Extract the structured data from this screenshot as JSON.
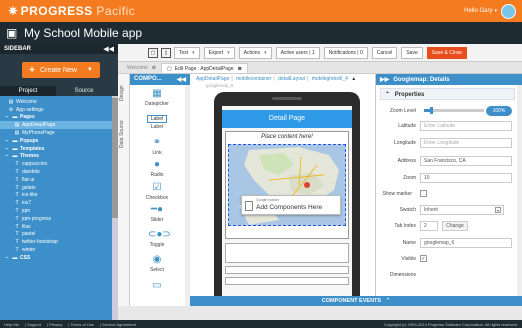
{
  "brand": {
    "name": "PROGRESS",
    "product": "Pacific"
  },
  "user": {
    "greeting": "Hello Gary"
  },
  "app": {
    "title": "My School Mobile app"
  },
  "sidebar": {
    "heading": "SIDEBAR",
    "create_label": "Create New",
    "tabs": [
      "Project",
      "Source"
    ],
    "tree": [
      {
        "label": "Welcome",
        "icon": "doc"
      },
      {
        "label": "App settings",
        "icon": "gear"
      },
      {
        "label": "Pages",
        "icon": "folder"
      },
      {
        "label": "AppDetailPage",
        "icon": "doc"
      },
      {
        "label": "MyPhonePage",
        "icon": "doc"
      },
      {
        "label": "Popups",
        "icon": "folder"
      },
      {
        "label": "Templates",
        "icon": "folder"
      },
      {
        "label": "Themes",
        "icon": "folder"
      },
      {
        "label": "cappuccino",
        "icon": "T"
      },
      {
        "label": "dandelo",
        "icon": "T"
      },
      {
        "label": "flat-ui",
        "icon": "T"
      },
      {
        "label": "gelato",
        "icon": "T"
      },
      {
        "label": "ice-like",
        "icon": "T"
      },
      {
        "label": "ios7",
        "icon": "T"
      },
      {
        "label": "jqm",
        "icon": "T"
      },
      {
        "label": "jqm-progress",
        "icon": "T"
      },
      {
        "label": "lilax",
        "icon": "T"
      },
      {
        "label": "pastel",
        "icon": "T"
      },
      {
        "label": "twitter-bootstrap",
        "icon": "T"
      },
      {
        "label": "winter",
        "icon": "T"
      },
      {
        "label": "CSS",
        "icon": "folder"
      }
    ]
  },
  "toolbar": {
    "test": "Test",
    "export": "Export",
    "actions": "Actions",
    "active_users": "Active users | 1",
    "notifications": "Notifications | 0",
    "cancel": "Cancel",
    "save": "Save",
    "save_close": "Save & Close"
  },
  "tabs": [
    {
      "label": "Welcome"
    },
    {
      "label": "Edit Page : AppDetailPage"
    }
  ],
  "vertical_tabs": [
    "Design",
    "Data Source"
  ],
  "palette": {
    "heading": "COMPO...",
    "items": [
      "Datepicker",
      "Label",
      "Link",
      "Radio",
      "Checkbox",
      "Slider",
      "Toggle",
      "Select"
    ]
  },
  "breadcrumb": {
    "items": [
      "AppDetailPage",
      "mobilecontainer",
      "detailLayout",
      "mobilegridcell_4"
    ],
    "sub": "googlemap_6"
  },
  "phone": {
    "header": "Detail Page",
    "placeholder": "Place content here!",
    "map_small": "Google marker",
    "add_components": "Add Components Here"
  },
  "properties": {
    "heading": "Googlemap: Details",
    "section": "Properties",
    "rows": [
      {
        "label": "Zoom Level",
        "value": "100%"
      },
      {
        "label": "Latitude",
        "placeholder": "Enter Latitude"
      },
      {
        "label": "Longitude",
        "placeholder": "Enter Longitude"
      },
      {
        "label": "Address",
        "value": "San Francisco, CA"
      },
      {
        "label": "Zoom",
        "value": "10"
      },
      {
        "label": "Show marker",
        "value": ""
      },
      {
        "label": "Swatch",
        "value": "Inherit"
      },
      {
        "label": "Tab Index",
        "value": "2",
        "button": "Change"
      },
      {
        "label": "Name",
        "value": "googlemap_6"
      },
      {
        "label": "Visible",
        "value": ""
      },
      {
        "label": "Dimensions",
        "value": ""
      }
    ],
    "zoom_level_fraction": 0.1
  },
  "events": {
    "label": "COMPONENT EVENTS"
  },
  "footer": {
    "links": [
      "Help Me",
      "Support",
      "Privacy",
      "Terms of Use",
      "Service Agreement"
    ],
    "copyright": "Copyright (c) 1993-2014 Progress Software Corporation. All rights reserved."
  },
  "colors": {
    "brand": "#f47b20",
    "accent": "#3c8fc8",
    "dark": "#1e2b33",
    "save": "#e84e1b"
  }
}
